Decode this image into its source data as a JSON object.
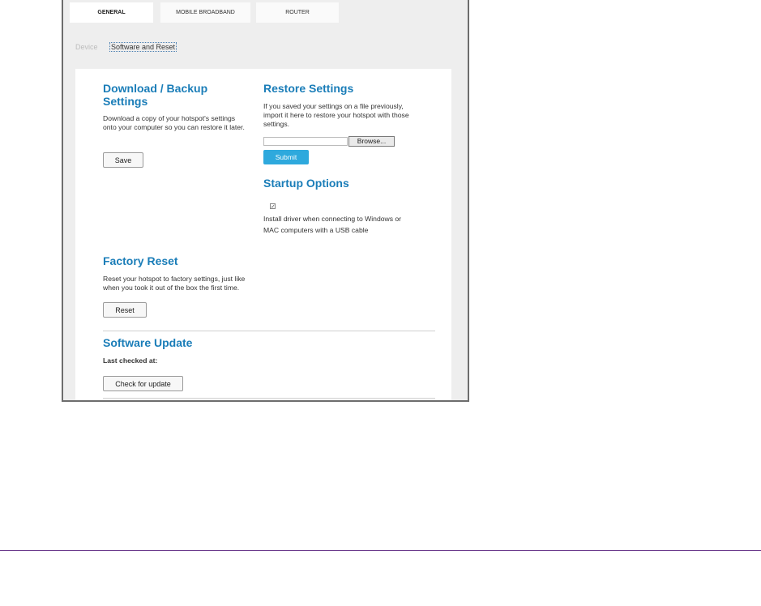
{
  "tabs": [
    {
      "label": "GENERAL",
      "active": true
    },
    {
      "label": "MOBILE BROADBAND",
      "active": false
    },
    {
      "label": "ROUTER",
      "active": false
    }
  ],
  "breadcrumb": {
    "parent": "Device",
    "current": "Software and Reset"
  },
  "download": {
    "title": "Download / Backup Settings",
    "description": "Download a copy of your hotspot's settings onto your computer so you can restore it later.",
    "button": "Save"
  },
  "restore": {
    "title": "Restore Settings",
    "description": "If you saved your settings on a file previously, import it here to restore your hotspot with those settings.",
    "file_value": "",
    "browse_button": "Browse...",
    "submit_button": "Submit"
  },
  "startup": {
    "title": "Startup Options",
    "checkbox_checked": true,
    "checkbox_mark": "✓",
    "checkbox_label": "Install driver when connecting to Windows or MAC computers with a USB cable"
  },
  "factory": {
    "title": "Factory Reset",
    "description": "Reset your hotspot to factory settings, just like when you took it out of the box the first time.",
    "button": "Reset"
  },
  "update": {
    "title": "Software Update",
    "last_checked_label": "Last checked at:",
    "button": "Check for update"
  },
  "colors": {
    "accent": "#1a7db8",
    "primary_button": "#2ea9dd",
    "footer_rule": "#6b3a8c"
  }
}
